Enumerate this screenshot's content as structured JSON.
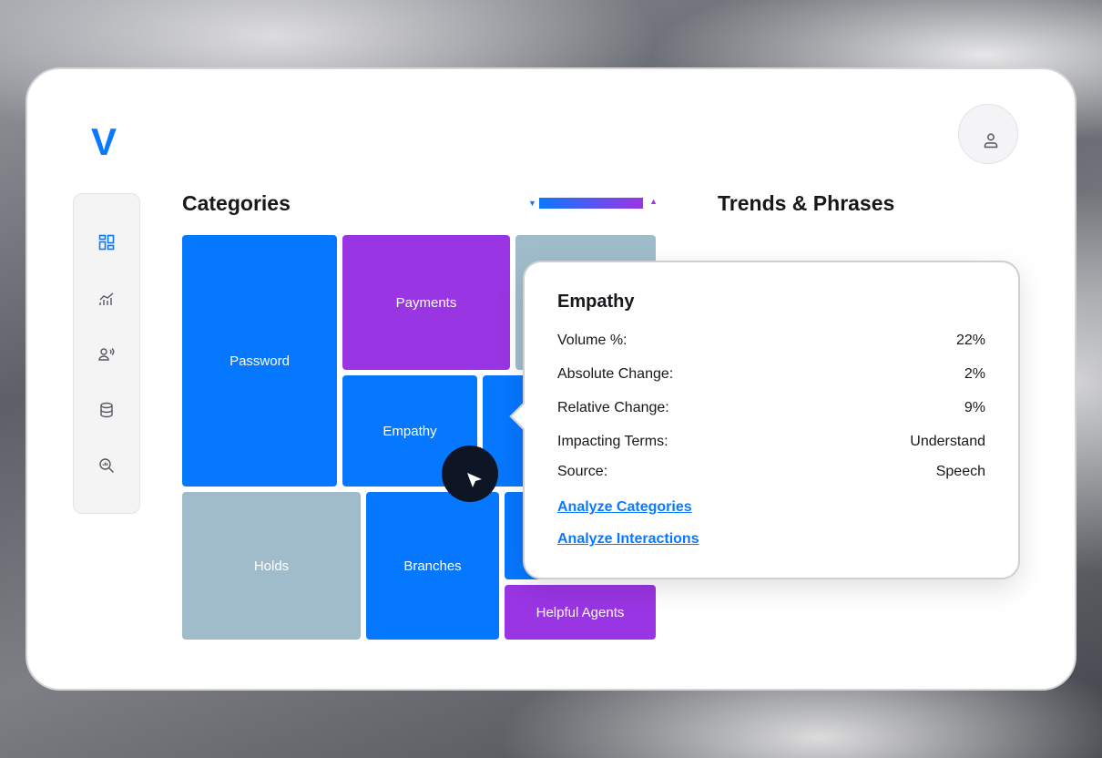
{
  "app": {
    "logo": "V"
  },
  "icons": {
    "avatar": "user-icon",
    "sidebar": [
      "dashboard-icon",
      "chart-icon",
      "speaker-user-icon",
      "database-icon",
      "search-chart-icon"
    ],
    "cursor": "cursor-arrow-icon"
  },
  "colors": {
    "accent": "#0677ff",
    "purple": "#9935e3",
    "grey": "#a0bccb",
    "cursor_bg": "#0e1524"
  },
  "categories": {
    "title": "Categories",
    "legend": {
      "low_marker": "▼",
      "high_marker": "▲"
    },
    "tiles": {
      "password": "Password",
      "payments": "Payments",
      "empathy": "Empathy",
      "holds": "Holds",
      "branches": "Branches",
      "helpful_agents": "Helpful Agents"
    }
  },
  "trends": {
    "title": "Trends & Phrases"
  },
  "tooltip": {
    "title": "Empathy",
    "rows": [
      {
        "label": "Volume %:",
        "value": "22%"
      },
      {
        "label": "Absolute Change:",
        "value": "2%"
      },
      {
        "label": "Relative Change:",
        "value": "9%"
      },
      {
        "label": "Impacting Terms:",
        "value": "Understand"
      },
      {
        "label": "Source:",
        "value": "Speech"
      }
    ],
    "links": [
      "Analyze Categories",
      "Analyze Interactions"
    ]
  }
}
